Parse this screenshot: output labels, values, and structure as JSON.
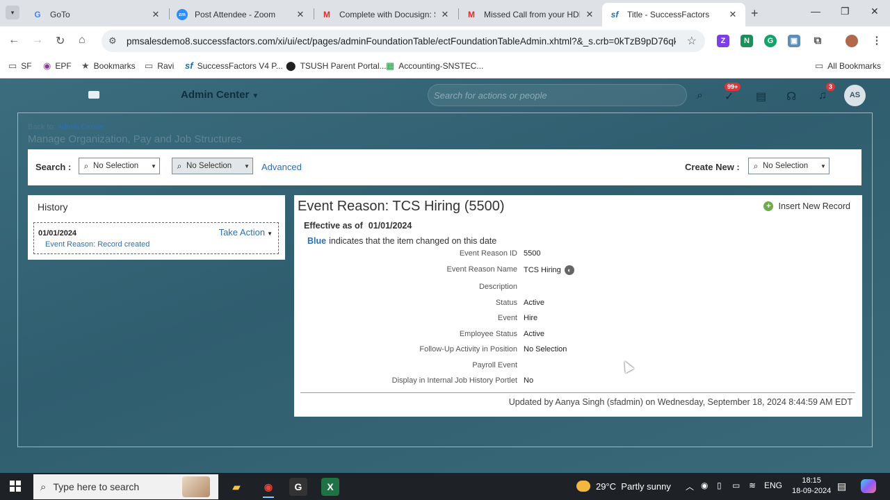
{
  "browser": {
    "tabs": [
      {
        "label": "GoTo",
        "icon": "google-icon"
      },
      {
        "label": "Post Attendee - Zoom",
        "icon": "zoom-icon"
      },
      {
        "label": "Complete with Docusign: Se",
        "icon": "gmail-icon"
      },
      {
        "label": "Missed Call from your HDFC",
        "icon": "gmail-icon"
      },
      {
        "label": "Title - SuccessFactors",
        "icon": "sf-icon",
        "active": true
      }
    ],
    "new_tab": "+",
    "url": "pmsalesdemo8.successfactors.com/xi/ui/ect/pages/adminFoundationTable/ectFoundationTableAdmin.xhtml?&_s.crb=0kTzB9pD76qkb8...",
    "bookmarks": [
      {
        "label": "SF",
        "icon": "folder-icon"
      },
      {
        "label": "EPF",
        "icon": "epf-icon"
      },
      {
        "label": "Bookmarks",
        "icon": "star-icon"
      },
      {
        "label": "Ravi",
        "icon": "folder-icon"
      },
      {
        "label": "SuccessFactors V4 P...",
        "icon": "sf-icon"
      },
      {
        "label": "TSUSH Parent Portal...",
        "icon": "tsush-icon"
      },
      {
        "label": "Accounting-SNSTEC...",
        "icon": "sheets-icon"
      }
    ],
    "all_bookmarks": "All Bookmarks"
  },
  "sf": {
    "module": "Admin Center",
    "search_placeholder": "Search for actions or people",
    "todo_badge": "99+",
    "notification_badge": "3",
    "avatar_initials": "AS",
    "back_to_prefix": "Back to:",
    "back_to_link": "Admin Center",
    "page_title": "Manage Organization, Pay and Job Structures",
    "search_label": "Search :",
    "search_select_1": "No Selection",
    "search_select_2": "No Selection",
    "advanced": "Advanced",
    "create_new_label": "Create New :",
    "create_new_select": "No Selection",
    "history": {
      "title": "History",
      "entry_date": "01/01/2024",
      "take_action": "Take Action",
      "entry_desc": "Event Reason: Record created"
    },
    "detail": {
      "title": "Event Reason: TCS Hiring (5500)",
      "insert": "Insert New Record",
      "effective_label": "Effective as of",
      "effective_date": "01/01/2024",
      "legend_blue": "Blue",
      "legend_text": "indicates that the item changed on this date",
      "fields": [
        {
          "label": "Event Reason ID",
          "value": "5500"
        },
        {
          "label": "Event Reason Name",
          "value": "TCS Hiring"
        },
        {
          "label": "Description",
          "value": ""
        },
        {
          "label": "Status",
          "value": "Active"
        },
        {
          "label": "Event",
          "value": "Hire"
        },
        {
          "label": "Employee Status",
          "value": "Active"
        },
        {
          "label": "Follow-Up Activity in Position",
          "value": "No Selection"
        },
        {
          "label": "Payroll Event",
          "value": ""
        },
        {
          "label": "Display in Internal Job History Portlet",
          "value": "No"
        }
      ],
      "updated": "Updated by Aanya Singh (sfadmin) on Wednesday, September 18, 2024 8:44:59 AM EDT"
    }
  },
  "taskbar": {
    "search_placeholder": "Type here to search",
    "weather_temp": "29°C",
    "weather_desc": "Partly sunny",
    "lang": "ENG",
    "time": "18:15",
    "date": "18-09-2024"
  },
  "colors": {
    "sf_background": "#3b6d7e",
    "link_blue": "#2e6fb0",
    "badge_red": "#d9363e"
  }
}
